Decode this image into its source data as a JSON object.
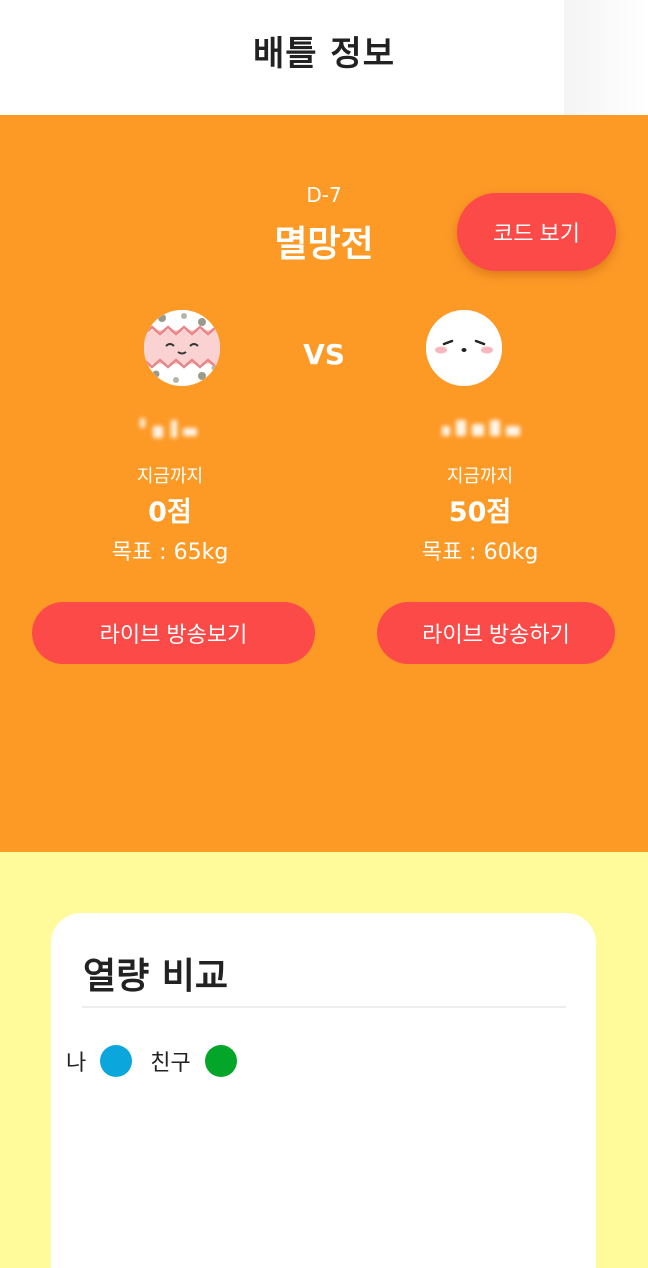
{
  "header": {
    "title": "배틀 정보"
  },
  "battle": {
    "d_day": "D-7",
    "title": "멸망전",
    "code_button": "코드 보기",
    "vs_label": "VS",
    "me": {
      "so_far_label": "지금까지",
      "score": "0점",
      "goal": "목표 : 65kg",
      "live_button": "라이브 방송보기"
    },
    "friend": {
      "so_far_label": "지금까지",
      "score": "50점",
      "goal": "목표 : 60kg",
      "live_button": "라이브 방송하기"
    }
  },
  "comparison": {
    "title": "열량 비교",
    "legend": [
      {
        "label": "나",
        "color": "#0aa6dc"
      },
      {
        "label": "친구",
        "color": "#04a62a"
      }
    ]
  },
  "colors": {
    "battle_bg": "#fd9a26",
    "button_red": "#fc4a48",
    "page_bg": "#fffb9a"
  }
}
